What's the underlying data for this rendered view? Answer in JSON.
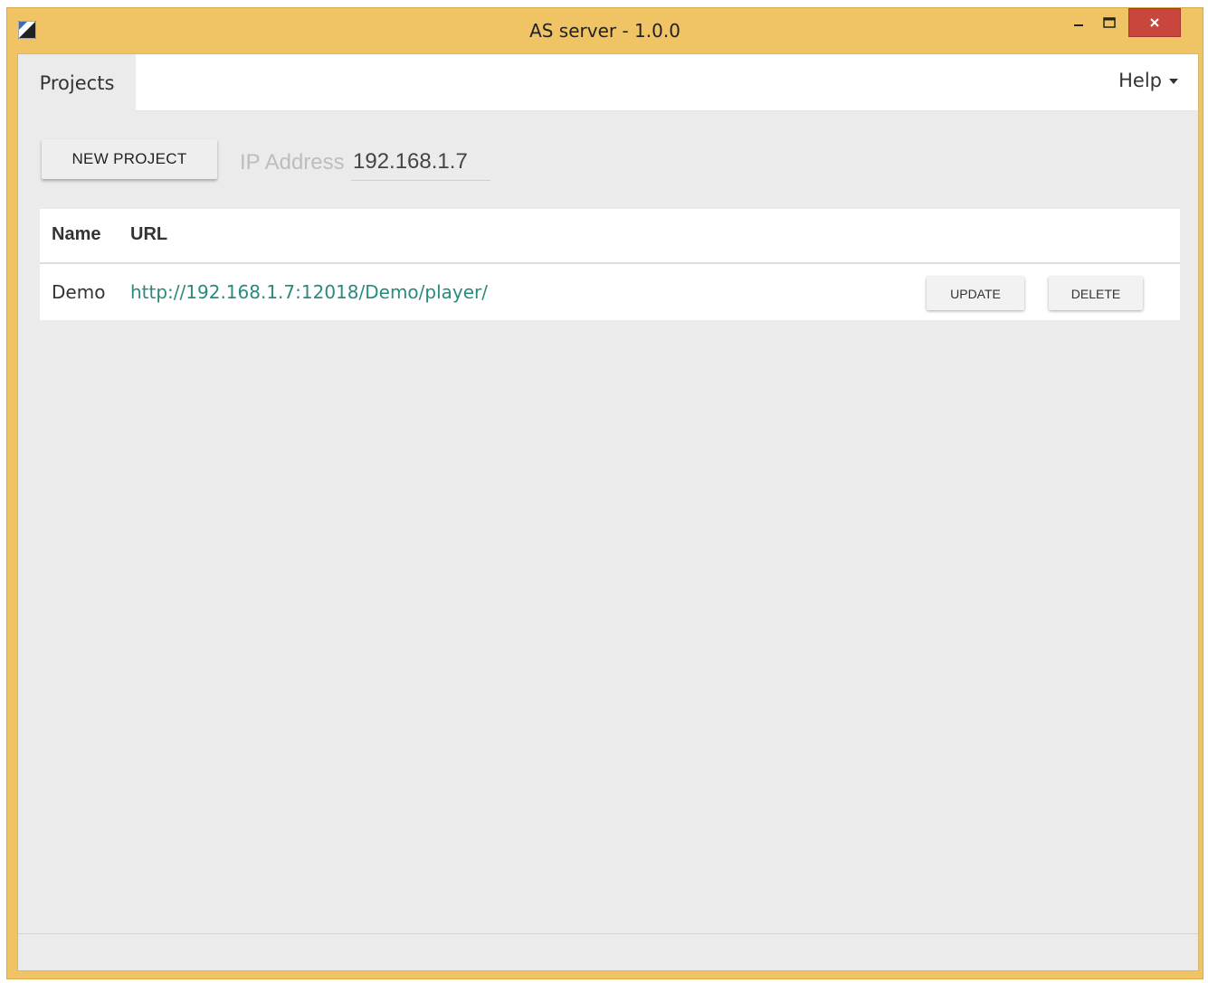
{
  "window": {
    "title": "AS server - 1.0.0",
    "icon": "app-icon"
  },
  "tabs": [
    {
      "label": "Projects",
      "active": true
    }
  ],
  "help_menu": {
    "label": "Help",
    "icon": "caret-down-icon"
  },
  "toolbar": {
    "new_project_label": "NEW PROJECT",
    "ip_label": "IP Address",
    "ip_value": "192.168.1.7"
  },
  "table": {
    "columns": [
      "Name",
      "URL"
    ],
    "rows": [
      {
        "name": "Demo",
        "url": "http://192.168.1.7:12018/Demo/player/",
        "update_label": "UPDATE",
        "delete_label": "DELETE"
      }
    ]
  },
  "colors": {
    "window_frame": "#f0c465",
    "close_button": "#c9463d",
    "link": "#2a8a7d",
    "background": "#ebebeb"
  }
}
